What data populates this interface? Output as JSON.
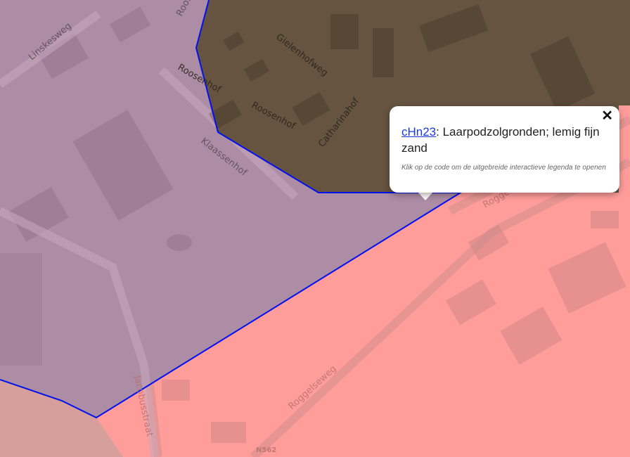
{
  "map": {
    "colors": {
      "base": "#ff9d9b",
      "purple_unit": "#ad8ca5",
      "brown_unit": "#665441",
      "bottom_left_unit": "#d79f9b",
      "boundary": "#0011ee"
    },
    "street_labels": [
      "Linskesweg",
      "Roosenhof",
      "Roosenhof",
      "Gielenhofweg",
      "Roosenhof",
      "Catharinahof",
      "Klaassenhof",
      "Roggelseweg",
      "Jacobusstraat",
      "Roggelseweg",
      "N562"
    ]
  },
  "popup": {
    "code": "cHn23",
    "separator": ": ",
    "description": "Laarpodzolgronden; lemig fijn zand",
    "hint": "Klik op de code om de uitgebreide interactieve legenda te openen",
    "close_label": "✕"
  }
}
